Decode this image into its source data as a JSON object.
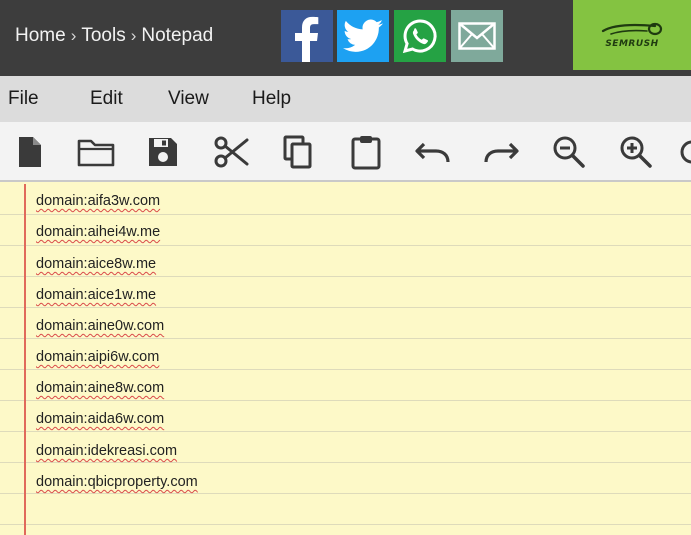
{
  "breadcrumb": {
    "home": "Home",
    "tools": "Tools",
    "current": "Notepad",
    "separator": "›"
  },
  "share": {
    "facebook": "facebook-icon",
    "twitter": "twitter-icon",
    "whatsapp": "whatsapp-icon",
    "email": "email-icon"
  },
  "brand": {
    "name": "SEMRUSH",
    "color": "#84c341"
  },
  "menu": {
    "file": "File",
    "edit": "Edit",
    "view": "View",
    "help": "Help"
  },
  "toolbar": [
    "new-file-icon",
    "open-folder-icon",
    "save-icon",
    "cut-icon",
    "copy-icon",
    "paste-icon",
    "undo-icon",
    "redo-icon",
    "zoom-out-icon",
    "zoom-in-icon"
  ],
  "colors": {
    "header": "#3d3d3d",
    "paper": "#fdf9c8",
    "margin": "#e06a5b",
    "facebook": "#3b5998",
    "twitter": "#1da1f2",
    "whatsapp": "#25a244",
    "email": "#7fa99b"
  },
  "editor": {
    "lines": [
      "domain:aifa3w.com",
      "domain:aihei4w.me",
      "domain:aice8w.me",
      "domain:aice1w.me",
      "domain:aine0w.com",
      "domain:aipi6w.com",
      "domain:aine8w.com",
      "domain:aida6w.com",
      "domain:idekreasi.com",
      "domain:qbicproperty.com"
    ]
  }
}
